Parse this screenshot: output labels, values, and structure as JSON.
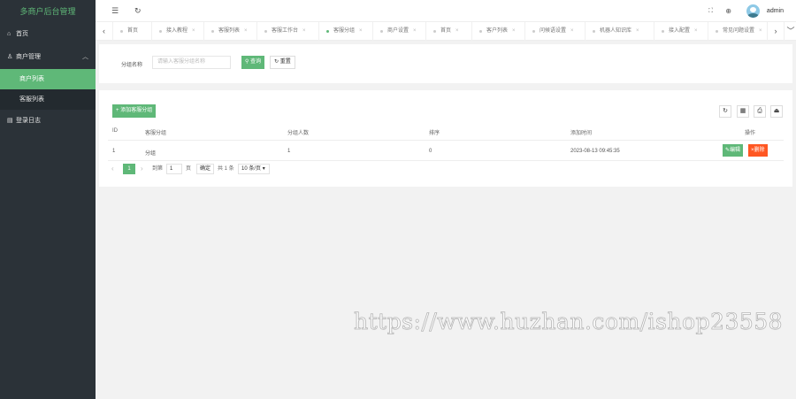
{
  "brand": "多商户后台管理",
  "sidebar": {
    "home": "首页",
    "merchant_mgmt": "商户管理",
    "sub": [
      "商户列表",
      "客服列表"
    ],
    "login_log": "登录日志"
  },
  "header": {
    "user": "admin"
  },
  "tabs": [
    "首页",
    "接入教程",
    "客服列表",
    "客服工作台",
    "客服分组",
    "商户设置",
    "首页",
    "客户列表",
    "问候语设置",
    "机器人知识库",
    "接入配置",
    "常见问题设置"
  ],
  "active_tab": "客服分组",
  "search": {
    "label": "分组名称",
    "placeholder": "请输入客服分组名称",
    "query_btn": "查询",
    "reset_btn": "重置"
  },
  "table": {
    "add_btn": "添加客服分组",
    "columns": [
      "ID",
      "客服分组",
      "分组人数",
      "排序",
      "添加时间",
      "操作"
    ],
    "rows": [
      {
        "id": "1",
        "group": "分组",
        "count": "1",
        "sort": "0",
        "time": "2023-08-13 09:45:35"
      }
    ],
    "edit_btn": "编辑",
    "delete_btn": "删除"
  },
  "pagination": {
    "current": "1",
    "goto_label": "到第",
    "page_input": "1",
    "page_unit": "页",
    "confirm": "确定",
    "total": "共 1 条",
    "per_page": "10 条/页"
  },
  "watermark": "https://www.huzhan.com/ishop23558",
  "colors": {
    "accent": "#5fb878",
    "danger": "#ff5722",
    "sidebar": "#2b3238"
  }
}
